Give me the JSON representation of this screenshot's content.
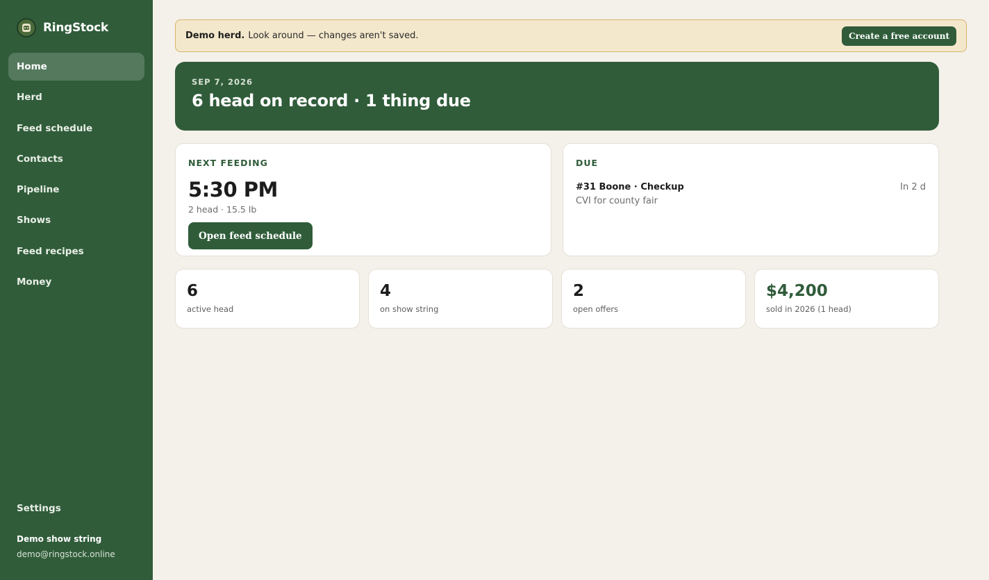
{
  "app": {
    "name": "RingStock",
    "logo_icon": "badge-logo-icon",
    "accent_color": "#305c3a"
  },
  "sidebar": {
    "items": [
      {
        "label": "Home",
        "active": true
      },
      {
        "label": "Herd",
        "active": false
      },
      {
        "label": "Feed schedule",
        "active": false
      },
      {
        "label": "Contacts",
        "active": false
      },
      {
        "label": "Pipeline",
        "active": false
      },
      {
        "label": "Shows",
        "active": false
      },
      {
        "label": "Feed recipes",
        "active": false
      },
      {
        "label": "Money",
        "active": false
      }
    ],
    "settings_label": "Settings",
    "account_name": "Demo show string",
    "account_email": "demo@ringstock.online"
  },
  "banner": {
    "strong": "Demo herd.",
    "text": "Look around — changes aren't saved.",
    "button_label": "Create a free account"
  },
  "hero": {
    "date": "SEP 7, 2026",
    "title": "6 head on record · 1 thing due"
  },
  "next_feeding": {
    "heading": "NEXT FEEDING",
    "time": "5:30 PM",
    "meta": "2 head · 15.5 lb",
    "button_label": "Open feed schedule"
  },
  "due": {
    "heading": "DUE",
    "items": [
      {
        "title": "#31 Boone · Checkup",
        "subtitle": "CVI for county fair",
        "when": "In 2 d"
      }
    ]
  },
  "stats": [
    {
      "value": "6",
      "label": "active head"
    },
    {
      "value": "4",
      "label": "on show string"
    },
    {
      "value": "2",
      "label": "open offers"
    },
    {
      "value": "$4,200",
      "label": "sold in 2026 (1 head)"
    }
  ]
}
